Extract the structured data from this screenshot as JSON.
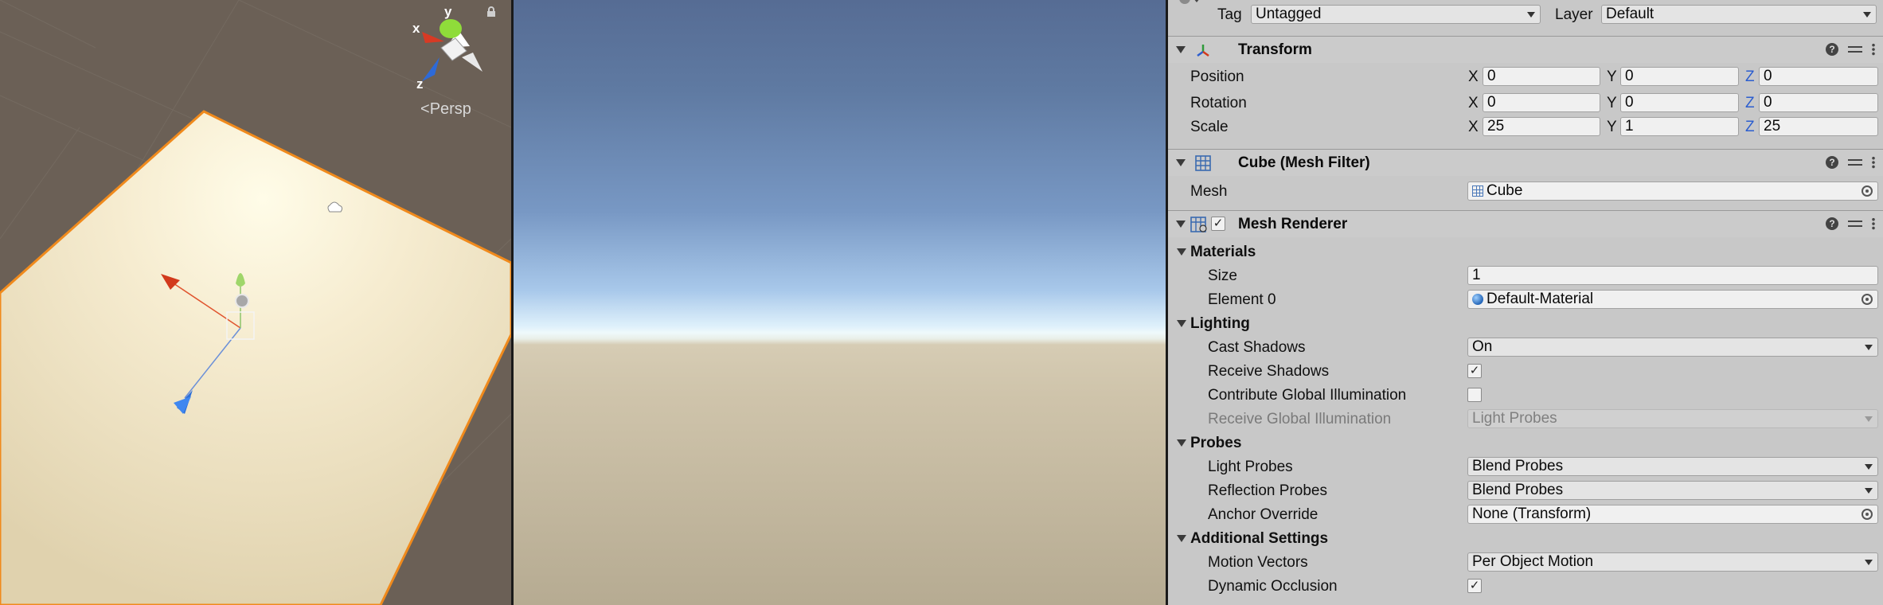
{
  "scene": {
    "projection_label": "Persp",
    "gizmo_axes": {
      "x": "x",
      "y": "y",
      "z": "z"
    }
  },
  "inspector": {
    "top": {
      "tag_label": "Tag",
      "tag_value": "Untagged",
      "layer_label": "Layer",
      "layer_value": "Default"
    },
    "transform": {
      "title": "Transform",
      "position_label": "Position",
      "rotation_label": "Rotation",
      "scale_label": "Scale",
      "axis_x": "X",
      "axis_y": "Y",
      "axis_z": "Z",
      "position": {
        "x": "0",
        "y": "0",
        "z": "0"
      },
      "rotation": {
        "x": "0",
        "y": "0",
        "z": "0"
      },
      "scale": {
        "x": "25",
        "y": "1",
        "z": "25"
      }
    },
    "mesh_filter": {
      "title": "Cube (Mesh Filter)",
      "mesh_label": "Mesh",
      "mesh_value": "Cube"
    },
    "mesh_renderer": {
      "title": "Mesh Renderer",
      "enabled": true,
      "materials_label": "Materials",
      "size_label": "Size",
      "size_value": "1",
      "element0_label": "Element 0",
      "element0_value": "Default-Material",
      "lighting_label": "Lighting",
      "cast_shadows_label": "Cast Shadows",
      "cast_shadows_value": "On",
      "receive_shadows_label": "Receive Shadows",
      "receive_shadows_checked": true,
      "contribute_gi_label": "Contribute Global Illumination",
      "contribute_gi_checked": false,
      "receive_gi_label": "Receive Global Illumination",
      "receive_gi_value": "Light Probes",
      "probes_label": "Probes",
      "light_probes_label": "Light Probes",
      "light_probes_value": "Blend Probes",
      "reflection_probes_label": "Reflection Probes",
      "reflection_probes_value": "Blend Probes",
      "anchor_override_label": "Anchor Override",
      "anchor_override_value": "None (Transform)",
      "additional_label": "Additional Settings",
      "motion_vectors_label": "Motion Vectors",
      "motion_vectors_value": "Per Object Motion",
      "dynamic_occlusion_label": "Dynamic Occlusion",
      "dynamic_occlusion_checked": true
    },
    "icons": {
      "help": "help-icon",
      "preset": "preset-icon",
      "menu": "kebab-menu-icon",
      "object_picker": "object-picker-icon"
    }
  },
  "colors": {
    "inspector_bg": "#c8c8c8",
    "selection_outline": "#f08a1c",
    "axis_z_label": "#2c5ecf"
  }
}
